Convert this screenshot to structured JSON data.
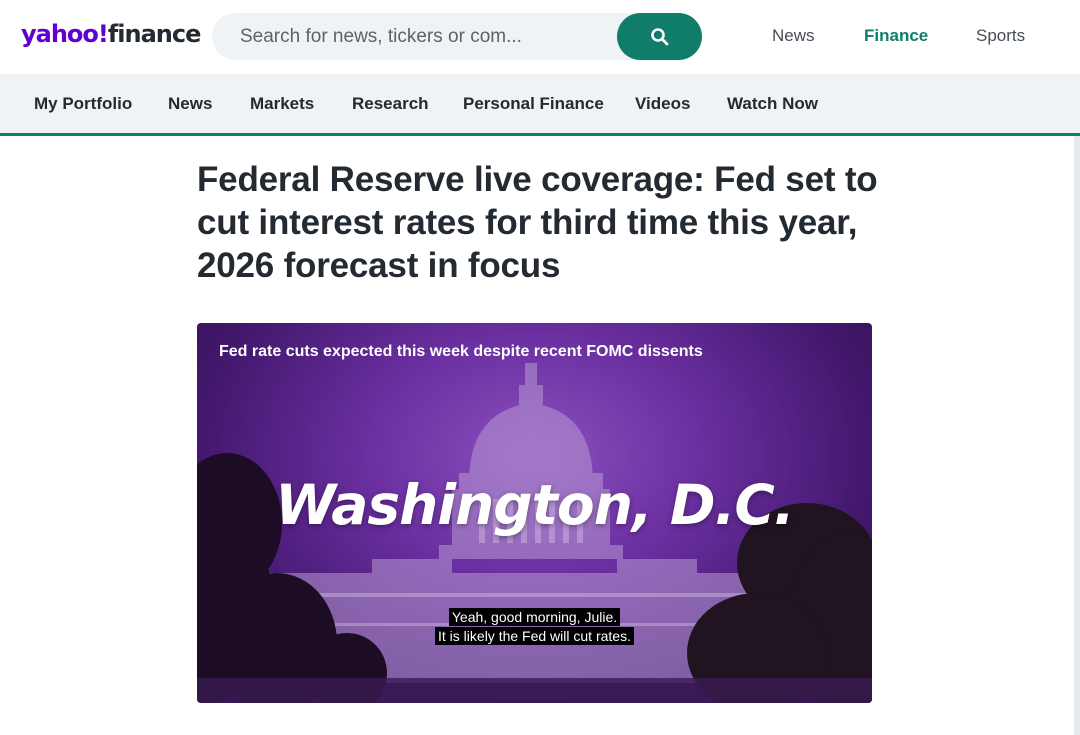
{
  "logo": {
    "yahoo": "yahoo",
    "slash": "!",
    "finance": "finance"
  },
  "search": {
    "placeholder": "Search for news, tickers or com...",
    "button_icon": "search-icon"
  },
  "top_links": [
    {
      "label": "News",
      "active": false
    },
    {
      "label": "Finance",
      "active": true
    },
    {
      "label": "Sports",
      "active": false
    }
  ],
  "nav": {
    "items": [
      "My Portfolio",
      "News",
      "Markets",
      "Research",
      "Personal Finance",
      "Videos",
      "Watch Now"
    ]
  },
  "article": {
    "headline": "Federal Reserve live coverage: Fed set to cut interest rates for third time this year, 2026 forecast in focus"
  },
  "video": {
    "title": "Fed rate cuts expected this week despite recent FOMC dissents",
    "overlay_text": "Washington, D.C.",
    "captions": [
      "Yeah, good morning, Julie.",
      "It is likely the Fed will cut rates."
    ]
  },
  "colors": {
    "brand_purple": "#6001d2",
    "finance_green": "#0f7d6a",
    "nav_bg": "#f0f3f5",
    "text_dark": "#232a31"
  }
}
